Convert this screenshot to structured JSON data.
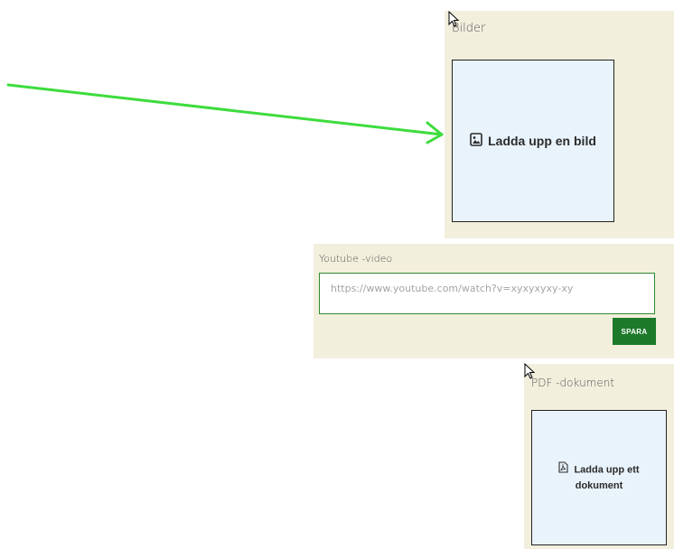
{
  "bilder": {
    "title": "Bilder",
    "upload_label": "Ladda upp en bild",
    "upload_icon": "image-file-icon"
  },
  "youtube": {
    "title": "Youtube -video",
    "placeholder": "https://www.youtube.com/watch?v=xyxyxyxy-xy",
    "value": "",
    "save_label": "SPARA"
  },
  "pdf": {
    "title": "PDF -dokument",
    "upload_label": "Ladda upp ett dokument",
    "upload_icon": "pdf-file-icon"
  },
  "annotation": {
    "arrow_color": "#3ddc3d",
    "arrow_icon": "arrow-right-icon"
  },
  "colors": {
    "panel_bg": "#f2efdd",
    "dropzone_bg": "#e9f3fb",
    "save_button_bg": "#1d7a2b",
    "input_border": "#2e8b2e"
  }
}
